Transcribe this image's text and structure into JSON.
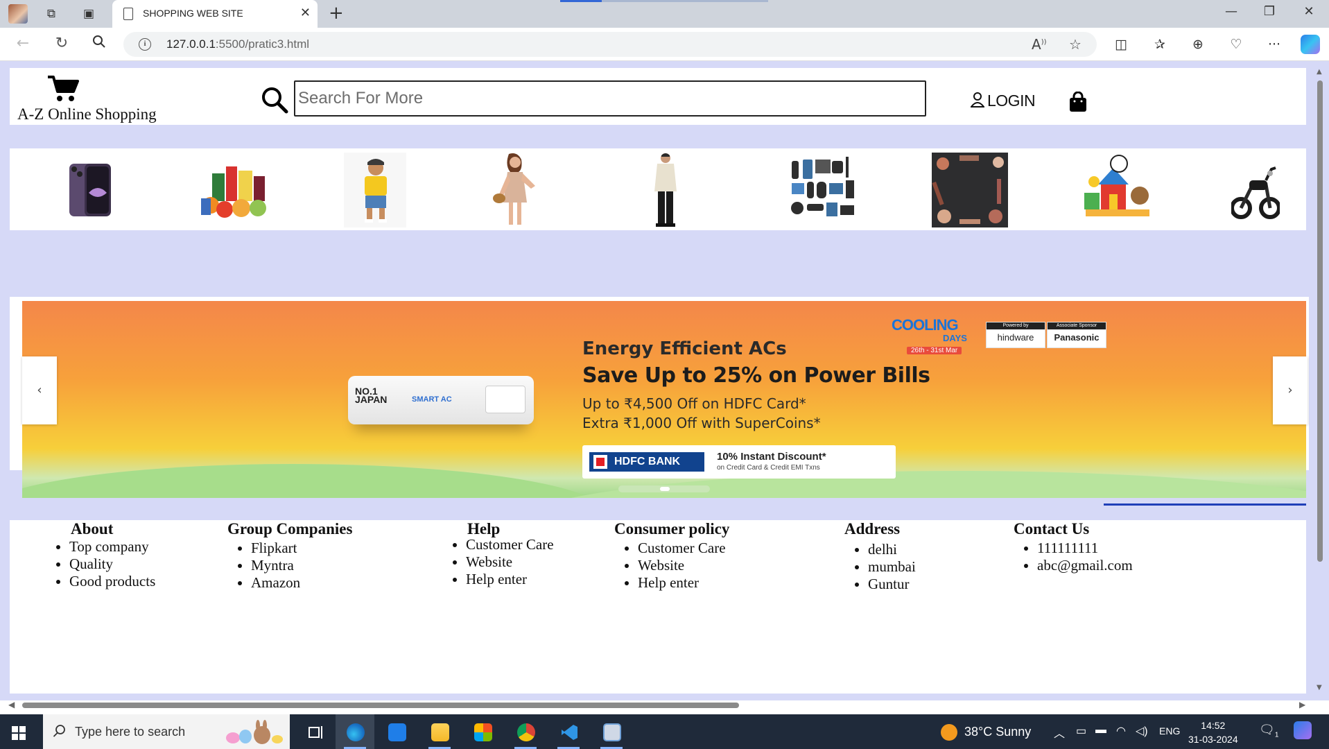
{
  "browser": {
    "tab_title": "SHOPPING WEB SITE",
    "url_host": "127.0.0.1",
    "url_rest": ":5500/pratic3.html"
  },
  "header": {
    "brand": "A-Z Online Shopping",
    "search_placeholder": "Search For More",
    "login_label": "LOGIN"
  },
  "categories": [
    {
      "icon": "phone-image"
    },
    {
      "icon": "grocery-image"
    },
    {
      "icon": "kids-fashion-image"
    },
    {
      "icon": "womens-fashion-image"
    },
    {
      "icon": "mens-fashion-image"
    },
    {
      "icon": "electronics-image"
    },
    {
      "icon": "beauty-image"
    },
    {
      "icon": "toys-image"
    },
    {
      "icon": "bike-image"
    }
  ],
  "banner": {
    "cooling_title": "COOLING",
    "cooling_days": "DAYS",
    "cooling_dates": "26th - 31st Mar",
    "sponsor1_top": "Powered by",
    "sponsor1": "hindware",
    "sponsor2_top": "Associate Sponsor",
    "sponsor2": "Panasonic",
    "ac_badge": "NO.1 JAPAN",
    "ac_brand": "SMART AC",
    "heading1": "Energy Efficient ACs",
    "heading2": "Save Up to 25% on Power Bills",
    "line1": "Up to ₹4,500 Off on HDFC Card*",
    "line2": "Extra ₹1,000 Off with SuperCoins*",
    "bank": "HDFC BANK",
    "discount": "10% Instant Discount*",
    "discount_sub": "on Credit Card & Credit EMI Txns"
  },
  "footer": {
    "columns": [
      {
        "title": "About",
        "items": [
          "Top company",
          "Quality",
          "Good products"
        ]
      },
      {
        "title": "Group Companies",
        "items": [
          "Flipkart",
          "Myntra",
          "Amazon"
        ]
      },
      {
        "title": "Help",
        "items": [
          "Customer Care",
          "Website",
          "Help enter"
        ]
      },
      {
        "title": "Consumer policy",
        "items": [
          "Customer Care",
          "Website",
          "Help enter"
        ]
      },
      {
        "title": "Address",
        "items": [
          "delhi",
          "mumbai",
          "Guntur"
        ]
      },
      {
        "title": "Contact Us",
        "items": [
          "111111111",
          "abc@gmail.com"
        ]
      }
    ]
  },
  "taskbar": {
    "search_placeholder": "Type here to search",
    "weather": "38°C  Sunny",
    "lang": "ENG",
    "time": "14:52",
    "date": "31-03-2024",
    "notif_count": "1"
  },
  "colors": {
    "page_bg": "#d6d9f7",
    "banner_orange": "#f7a13b",
    "hdfc_blue": "#11438e",
    "taskbar": "#1f2a3a"
  }
}
